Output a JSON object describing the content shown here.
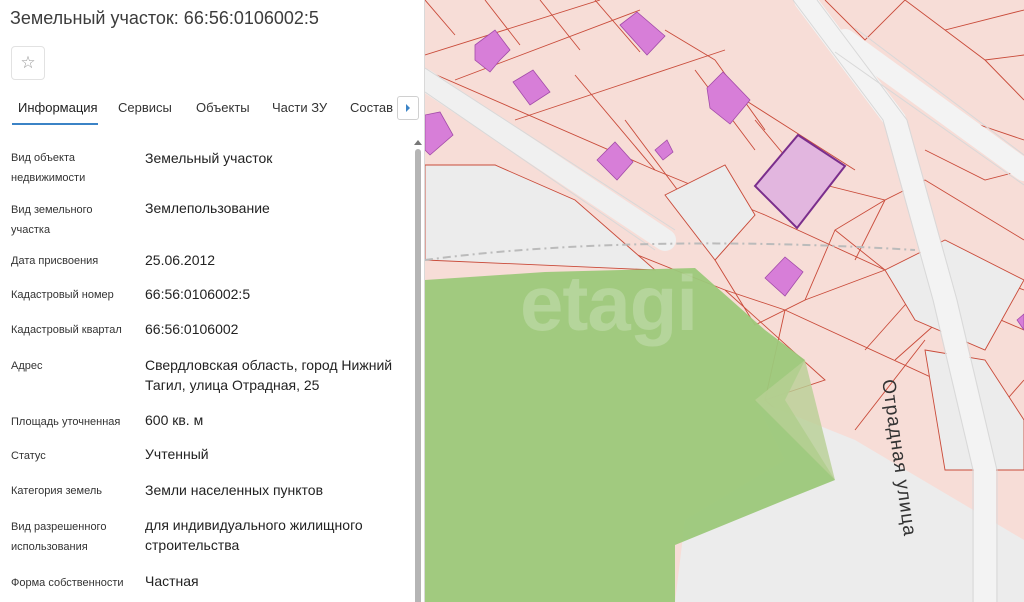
{
  "title": "Земельный участок: 66:56:0106002:5",
  "tabs": [
    {
      "label": "Информация"
    },
    {
      "label": "Сервисы"
    },
    {
      "label": "Объекты"
    },
    {
      "label": "Части ЗУ"
    },
    {
      "label": "Состав"
    }
  ],
  "info": [
    {
      "label": "Вид объекта недвижимости",
      "value": "Земельный участок"
    },
    {
      "label": "Вид земельного участка",
      "value": "Землепользование"
    },
    {
      "label": "Дата присвоения",
      "value": "25.06.2012"
    },
    {
      "label": "Кадастровый номер",
      "value": "66:56:0106002:5"
    },
    {
      "label": "Кадастровый квартал",
      "value": "66:56:0106002"
    },
    {
      "label": "Адрес",
      "value": "Свердловская область, город Нижний Тагил, улица Отрадная, 25"
    },
    {
      "label": "Площадь уточненная",
      "value": "600 кв. м"
    },
    {
      "label": "Статус",
      "value": "Учтенный"
    },
    {
      "label": "Категория земель",
      "value": "Земли населенных пунктов"
    },
    {
      "label": "Вид разрешенного использования",
      "value": "для индивидуального жилищного строительства"
    },
    {
      "label": "Форма собственности",
      "value": "Частная"
    }
  ],
  "map": {
    "street_label": "Отрадная улица",
    "watermark": "etagi"
  },
  "icons": {
    "favorite": "star-icon",
    "tabs_next": "chevron-right-icon"
  },
  "colors": {
    "accent": "#3b83c6",
    "parcel_fill": "#f7ddd7",
    "parcel_border": "#c94b3a",
    "building": "#d77ed8",
    "selected_parcel": "#7a2e8c",
    "green_area": "#9cc87a"
  }
}
